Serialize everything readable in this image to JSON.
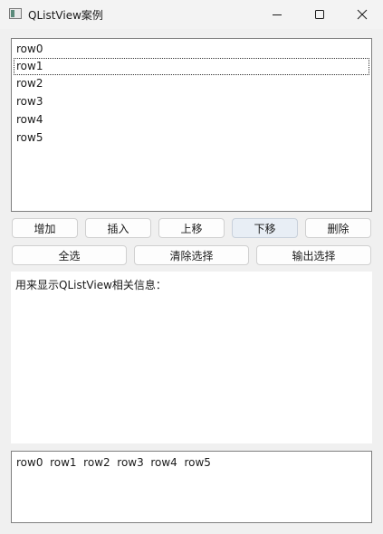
{
  "window": {
    "title": "QListView案例"
  },
  "list": {
    "items": [
      "row0",
      "row1",
      "row2",
      "row3",
      "row4",
      "row5"
    ],
    "current_index": 1
  },
  "buttons_row1": {
    "add": "增加",
    "insert": "插入",
    "move_up": "上移",
    "move_down": "下移",
    "delete": "删除"
  },
  "buttons_row2": {
    "select_all": "全选",
    "clear_selection": "清除选择",
    "output_selection": "输出选择"
  },
  "info": {
    "text": "用来显示QListView相关信息："
  },
  "output": {
    "text": "row0  row1  row2  row3  row4  row5"
  }
}
